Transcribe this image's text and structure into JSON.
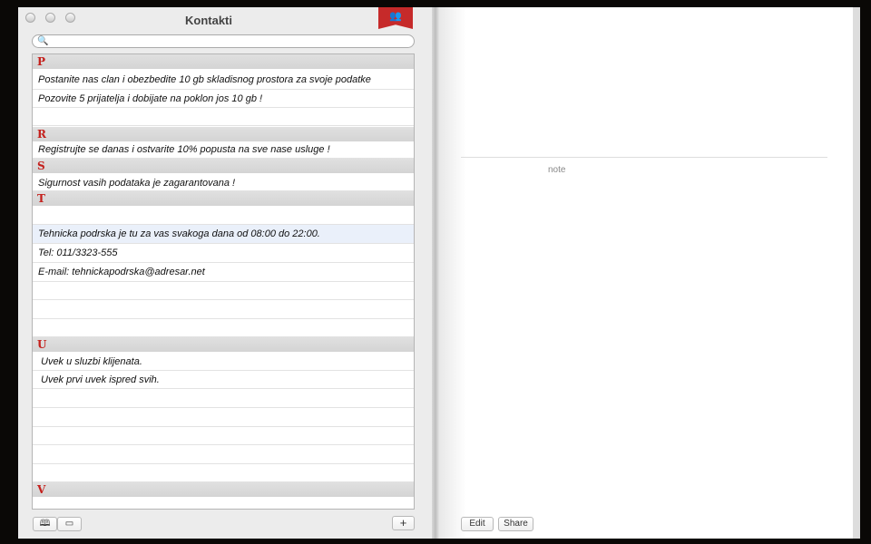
{
  "window": {
    "title": "Kontakti",
    "icon": "contacts-bookmark-icon"
  },
  "search": {
    "placeholder": "",
    "icon": "search-icon"
  },
  "sections": [
    {
      "letter": "P",
      "rows": [
        "Postanite nas clan i obezbedite  10 gb skladisnog prostora za svoje podatke",
        "Pozovite 5 prijatelja i dobijate na poklon jos 10 gb !"
      ]
    },
    {
      "letter": "R",
      "rows": [
        "Registrujte se danas i ostvarite 10% popusta na sve nase usluge !"
      ]
    },
    {
      "letter": "S",
      "rows": [
        "Sigurnost vasih podataka je zagarantovana !"
      ]
    },
    {
      "letter": "T",
      "rows": [
        "Tehnicka podrska je tu za vas svakoga dana od 08:00 do 22:00.",
        "Tel: 011/3323-555",
        "E-mail: tehnickapodrska@adresar.net"
      ]
    },
    {
      "letter": "U",
      "rows": [
        "Uvek u sluzbi klijenata.",
        "Uvek prvi uvek ispred svih."
      ]
    },
    {
      "letter": "V",
      "rows": []
    }
  ],
  "footer": {
    "add_label": "+",
    "book_icon": "book-view-icon",
    "card_icon": "card-view-icon"
  },
  "detail": {
    "note_label": "note",
    "edit_label": "Edit",
    "share_label": "Share"
  }
}
